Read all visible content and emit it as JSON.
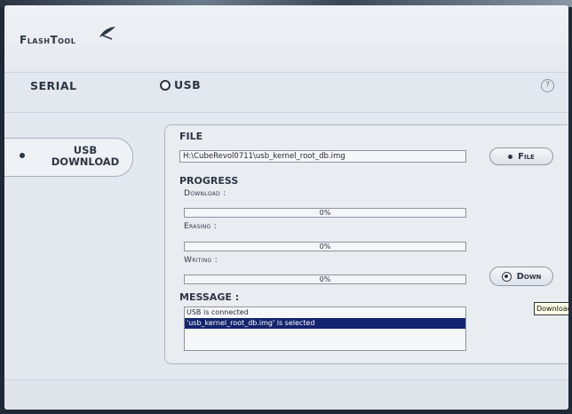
{
  "app": {
    "title": "FlashTool"
  },
  "mode": {
    "serial_label": "SERIAL",
    "usb_label": "USB",
    "help_symbol": "?"
  },
  "sidebar": {
    "download_label_1": "USB",
    "download_label_2": "DOWNLOAD"
  },
  "file": {
    "heading": "FILE",
    "path": "H:\\CubeRevol0711\\usb_kernel_root_db.img",
    "button_label": "File"
  },
  "progress": {
    "heading": "PROGRESS",
    "download": {
      "label": "Download :",
      "percent_text": "0%",
      "value": 0
    },
    "erasing": {
      "label": "Erasing :",
      "percent_text": "0%",
      "value": 0
    },
    "writing": {
      "label": "Writing :",
      "percent_text": "0%",
      "value": 0
    },
    "down_button_label": "Down"
  },
  "message": {
    "heading": "MESSAGE :",
    "lines": [
      {
        "text": "USB is connected",
        "selected": false
      },
      {
        "text": "'usb_kernel_root_db.img' is selected",
        "selected": true
      }
    ]
  },
  "tooltip": {
    "text": "Download"
  },
  "icons": {
    "logo": "feather-pen-icon",
    "help": "help-circle-icon"
  },
  "colors": {
    "selection": "#15246e",
    "text": "#2c3644"
  }
}
